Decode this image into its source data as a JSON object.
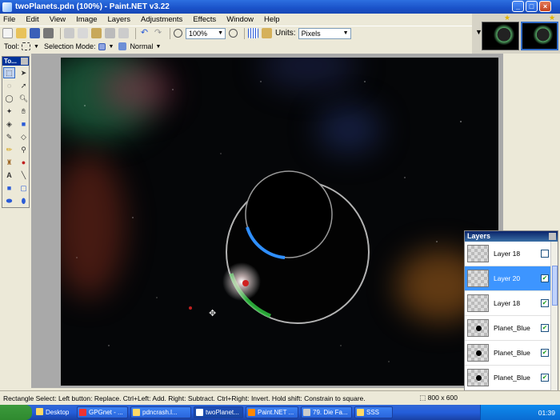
{
  "window": {
    "title": "twoPlanets.pdn (100%) - Paint.NET v3.22"
  },
  "menu": [
    "File",
    "Edit",
    "View",
    "Image",
    "Layers",
    "Adjustments",
    "Effects",
    "Window",
    "Help"
  ],
  "toolbar": {
    "zoom_value": "100%",
    "units_label": "Units:",
    "units_value": "Pixels"
  },
  "tool_options": {
    "tool_label": "Tool:",
    "selection_mode_label": "Selection Mode:",
    "blend_mode": "Normal"
  },
  "tools_panel": {
    "title": "To..."
  },
  "layers_panel": {
    "title": "Layers",
    "layers": [
      {
        "name": "Layer 18",
        "checked": false,
        "selected": false,
        "planet": false
      },
      {
        "name": "Layer 20",
        "checked": true,
        "selected": true,
        "planet": false
      },
      {
        "name": "Layer 18",
        "checked": true,
        "selected": false,
        "planet": false
      },
      {
        "name": "Planet_Blue",
        "checked": true,
        "selected": false,
        "planet": true
      },
      {
        "name": "Planet_Blue",
        "checked": true,
        "selected": false,
        "planet": true
      },
      {
        "name": "Planet_Blue",
        "checked": true,
        "selected": false,
        "planet": true
      }
    ]
  },
  "status": {
    "hint": "Rectangle Select: Left button: Replace. Ctrl+Left: Add. Right: Subtract. Ctrl+Right: Invert. Hold shift: Constrain to square.",
    "image_size": "800 x 600"
  },
  "taskbar": {
    "items": [
      "Desktop",
      "GPGnet - ...",
      "pdncrash.l...",
      "twoPlanet...",
      "Paint.NET ...",
      "79. Die Fa...",
      "SSS"
    ],
    "clock": "01:39"
  }
}
